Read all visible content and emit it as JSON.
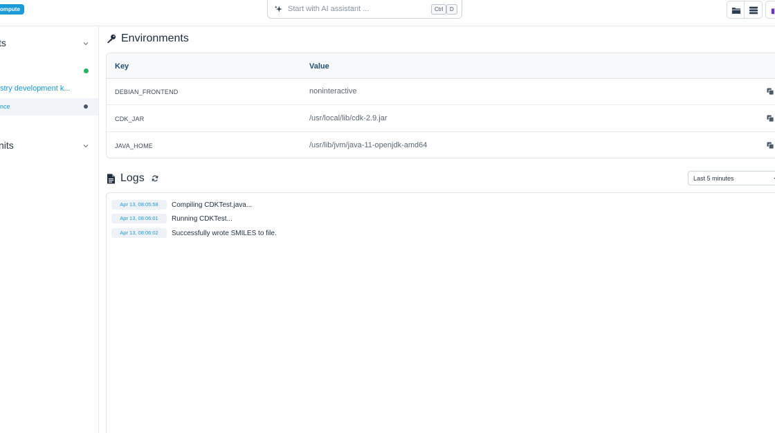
{
  "topbar": {
    "badge": "ompute",
    "assistant_placeholder": "Start with AI assistant ...",
    "shortcut": [
      "Ctrl",
      "D"
    ]
  },
  "sidebar": {
    "section1_title": "ts",
    "items": [
      {
        "label": "stry development k...",
        "status_color": "#22b35e"
      },
      {
        "label": "nce",
        "status_color": "#4b5563"
      }
    ],
    "section2_title": "nits"
  },
  "environments": {
    "title": "Environments",
    "columns": [
      "Key",
      "Value"
    ],
    "rows": [
      {
        "key": "DEBIAN_FRONTEND",
        "value": "noninteractive"
      },
      {
        "key": "CDK_JAR",
        "value": "/usr/local/lib/cdk-2.9.jar"
      },
      {
        "key": "JAVA_HOME",
        "value": "/usr/lib/jvm/java-11-openjdk-amd64"
      }
    ]
  },
  "logs": {
    "title": "Logs",
    "time_range": "Last 5 minutes",
    "entries": [
      {
        "timestamp": "Apr 13, 08:05:58",
        "message": "Compiling CDKTest.java..."
      },
      {
        "timestamp": "Apr 13, 08:06:01",
        "message": "Running CDKTest..."
      },
      {
        "timestamp": "Apr 13, 08:06:02",
        "message": "Successfully wrote SMILES to file."
      }
    ]
  },
  "colors": {
    "accent": "#1a9ad6",
    "status_green": "#22b35e",
    "status_gray": "#4b5563"
  },
  "icons": {
    "assistant": "sparkle-icon",
    "environments": "key-icon",
    "logs": "document-icon",
    "refresh": "refresh-icon",
    "copy": "copy-icon",
    "toolbar": [
      "folder-icon",
      "database-icon",
      "gift-icon"
    ]
  }
}
